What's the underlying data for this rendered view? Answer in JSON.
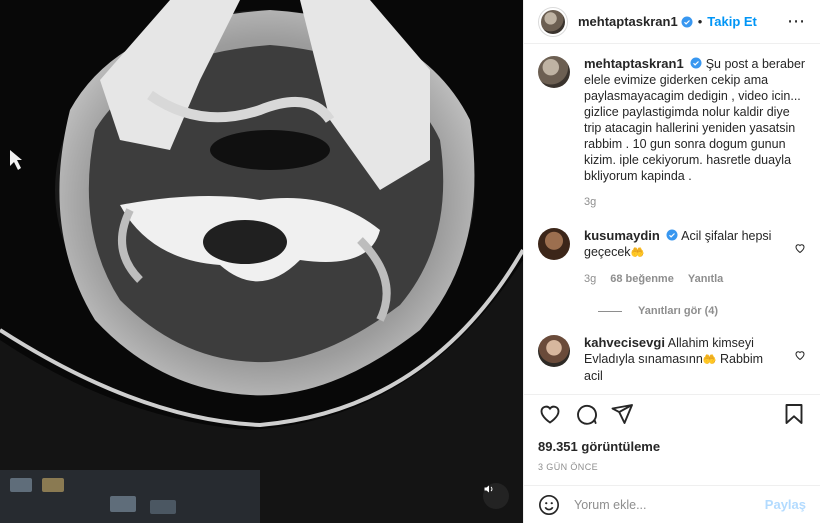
{
  "post": {
    "username": "mehtaptaskran1",
    "follow_label": "Takip Et",
    "more_icon": "⋯",
    "caption": "Şu post a beraber elele evimize giderken cekip ama paylasmayacagim dedigin , video icin... gizlice paylastigimda nolur kaldir diye trip atacagin hallerini yeniden yasatsin rabbim . 10 gun sonra dogum gunun kizim. iple cekiyorum. hasretle duayla bkliyorum kapinda .",
    "caption_time": "3g"
  },
  "comments": [
    {
      "username": "kusumaydin",
      "text": "Acil şifalar hepsi geçecek",
      "emoji": "🤲",
      "time": "3g",
      "likes": "68 beğenme",
      "reply_label": "Yanıtla",
      "view_replies": "Yanıtları gör (4)"
    },
    {
      "username": "kahvecisevgi",
      "text": "Allahim kimseyi Evladıyla sınamasınn",
      "emoji": "🤲",
      "text2": "Rabbim acil"
    }
  ],
  "stats": {
    "views": "89.351 görüntüleme",
    "time_ago": "3 GÜN ÖNCE"
  },
  "composer": {
    "placeholder": "Yorum ekle...",
    "post_label": "Paylaş"
  },
  "colors": {
    "accent": "#0095f6",
    "post_disabled": "#b3dbff",
    "muted": "#8e8e8e"
  },
  "icons": [
    "smiley-icon",
    "heart-icon",
    "comment-icon",
    "share-icon",
    "bookmark-icon",
    "volume-icon",
    "verified-icon"
  ]
}
